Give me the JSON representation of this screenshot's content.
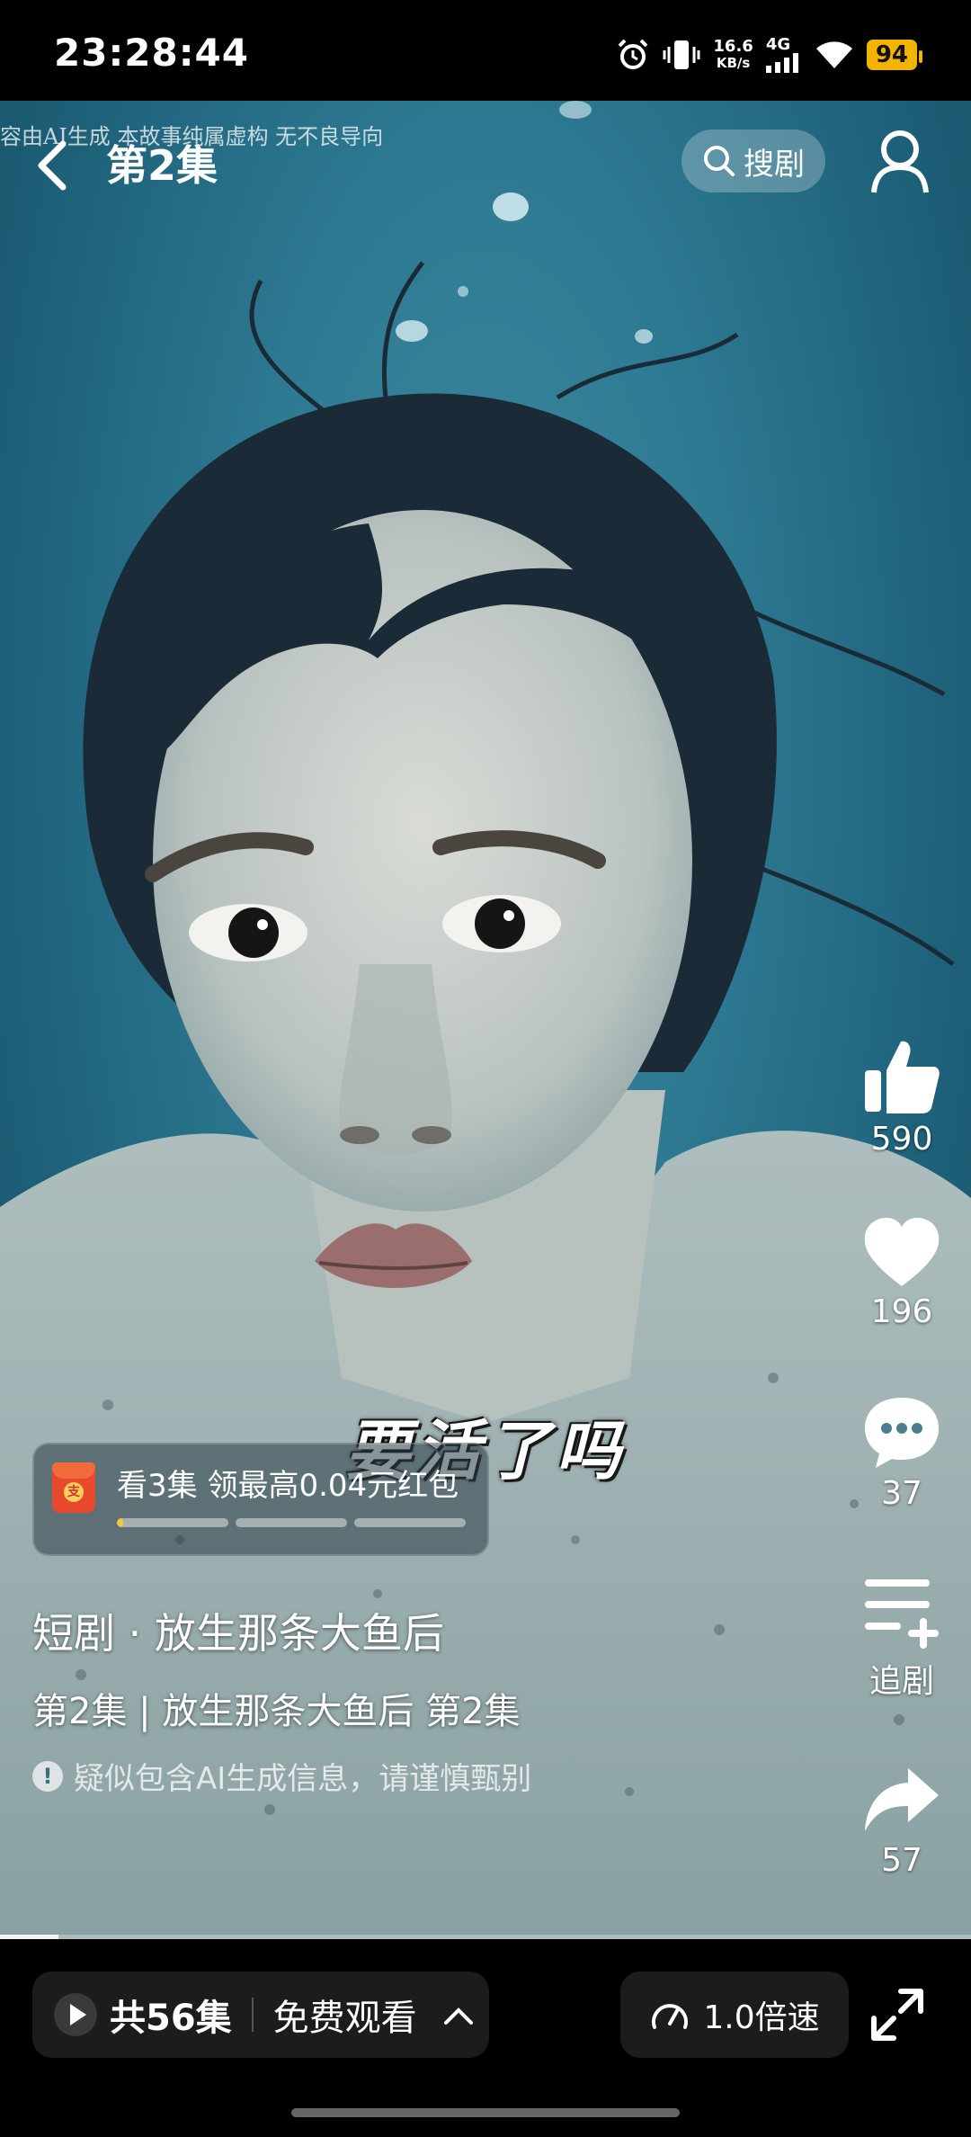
{
  "status_bar": {
    "time": "23:28:44",
    "net_speed_value": "16.6",
    "net_speed_unit": "KB/s",
    "network_type": "4G",
    "battery": "94",
    "icons": [
      "alarm-icon",
      "vibrate-icon",
      "signal-icon",
      "wifi-icon",
      "battery-icon"
    ]
  },
  "header": {
    "ai_notice": "容由AI生成 本故事纯属虚构 无不良导向",
    "episode_title": "第2集",
    "search_label": "搜剧"
  },
  "video": {
    "subtitle": "要活了吗",
    "progress_fraction": 0.06
  },
  "actions": {
    "like_count": "590",
    "favorite_count": "196",
    "comment_count": "37",
    "follow_label": "追剧",
    "share_count": "57"
  },
  "reward": {
    "text": "看3集 领最高0.04元红包",
    "segment_fill": [
      0.06,
      0,
      0
    ]
  },
  "info": {
    "drama_name": "短剧 · 放生那条大鱼后",
    "episode_line": "第2集 | 放生那条大鱼后 第2集",
    "ai_warning": "疑似包含AI生成信息，请谨慎甄别"
  },
  "bottom": {
    "episode_count": "共56集",
    "free_watch": "免费观看",
    "speed_label": "1.0倍速"
  },
  "colors": {
    "water": "#2d7a92",
    "battery": "#f3b400",
    "progress_accent": "#f6c53b"
  }
}
